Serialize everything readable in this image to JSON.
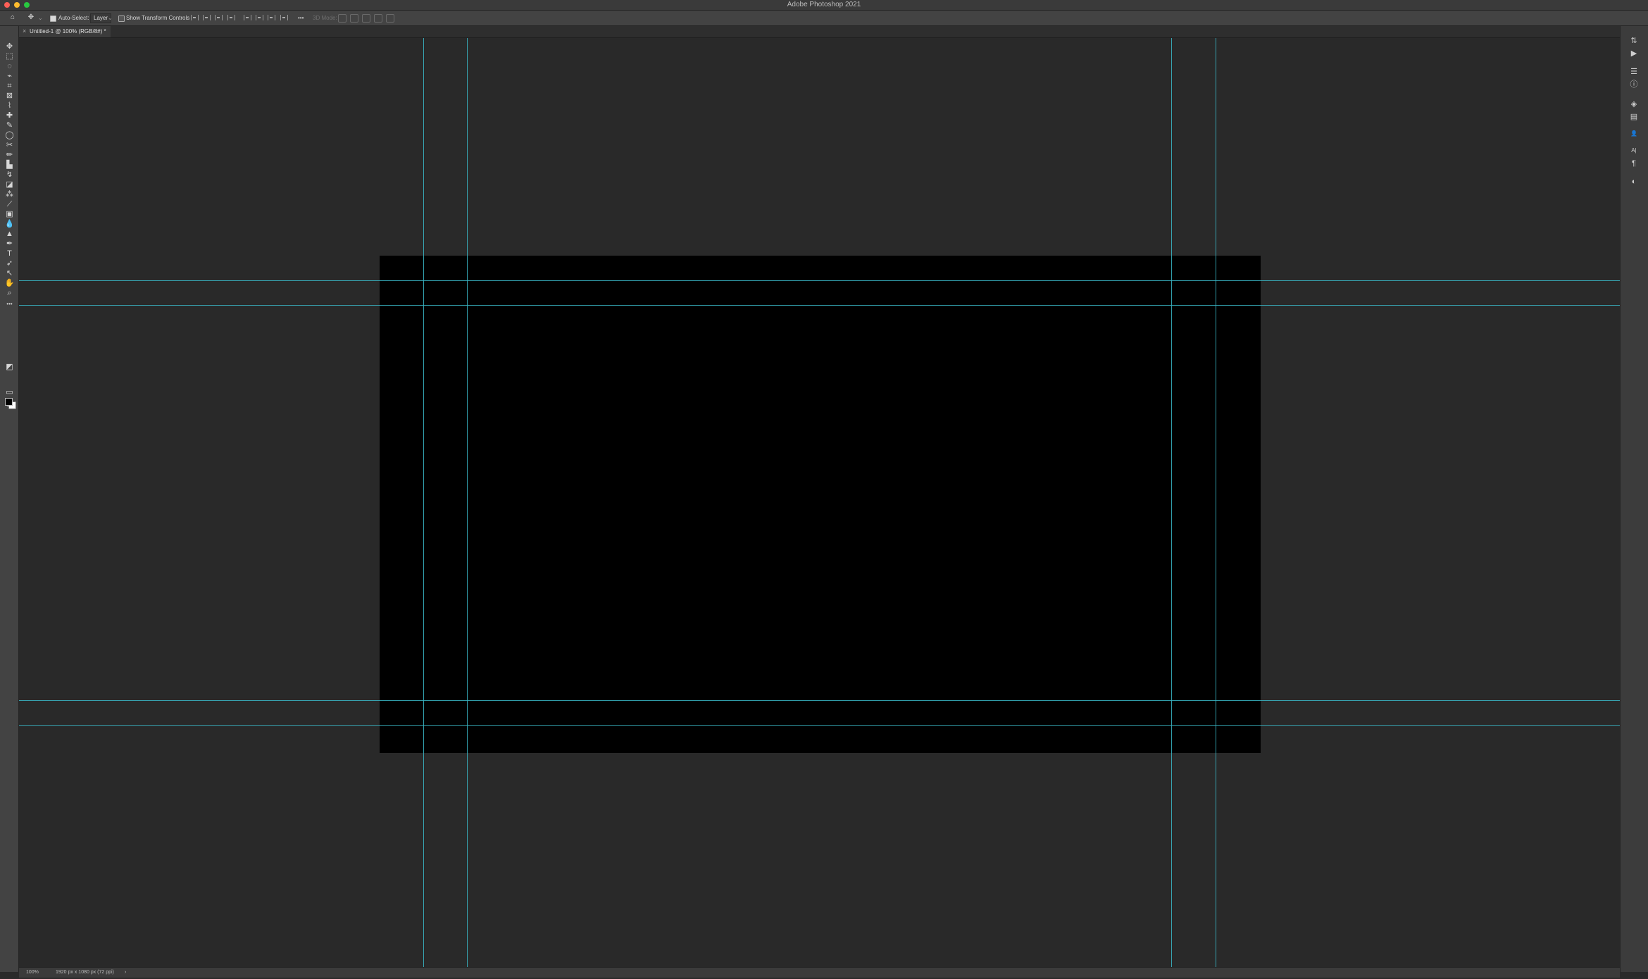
{
  "app_title": "Adobe Photoshop 2021",
  "options_bar": {
    "auto_select_label": "Auto-Select:",
    "auto_select_checked": true,
    "auto_select_target": "Layer",
    "show_transform_label": "Show Transform Controls",
    "show_transform_checked": false,
    "more_label": "•••",
    "mode_3d_label": "3D Mode:"
  },
  "document_tab": {
    "title": "Untitled-1 @ 100% (RGB/8#) *",
    "close_glyph": "×"
  },
  "tools": [
    {
      "name": "move-tool",
      "glyph": "✥"
    },
    {
      "name": "marquee-tool",
      "glyph": "⬚"
    },
    {
      "name": "lasso-tool",
      "glyph": "◌"
    },
    {
      "name": "object-select-tool",
      "glyph": "⌁"
    },
    {
      "name": "crop-tool",
      "glyph": "⌗"
    },
    {
      "name": "frame-tool",
      "glyph": "⊠"
    },
    {
      "name": "eyedropper-tool",
      "glyph": "⌇"
    },
    {
      "name": "healing-brush-tool",
      "glyph": "✚"
    },
    {
      "name": "brush-tool",
      "glyph": "✎"
    },
    {
      "name": "ellipse-tool",
      "glyph": "◯"
    },
    {
      "name": "scissors-tool",
      "glyph": "✂"
    },
    {
      "name": "pencil-tool",
      "glyph": "✏"
    },
    {
      "name": "stamp-tool",
      "glyph": "▙"
    },
    {
      "name": "history-brush-tool",
      "glyph": "↯"
    },
    {
      "name": "eraser-tool",
      "glyph": "◪"
    },
    {
      "name": "magic-wand-tool",
      "glyph": "⁂"
    },
    {
      "name": "brush-alt-tool",
      "glyph": "⟋"
    },
    {
      "name": "gradient-tool",
      "glyph": "▣"
    },
    {
      "name": "blur-tool",
      "glyph": "💧"
    },
    {
      "name": "dodge-tool",
      "glyph": "▲"
    },
    {
      "name": "pen-tool",
      "glyph": "✒"
    },
    {
      "name": "type-tool",
      "glyph": "T"
    },
    {
      "name": "path-select-tool",
      "glyph": "➶"
    },
    {
      "name": "direct-select-tool",
      "glyph": "↖"
    },
    {
      "name": "hand-tool",
      "glyph": "✋"
    },
    {
      "name": "zoom-tool",
      "glyph": "⌕"
    },
    {
      "name": "more-tools",
      "glyph": "•••"
    },
    {
      "name": "default-colors",
      "glyph": "◩"
    },
    {
      "name": "quick-mask",
      "glyph": "▭"
    },
    {
      "name": "screen-mode",
      "glyph": "⧉"
    }
  ],
  "right_panel_icons": [
    {
      "name": "history-panel-icon",
      "glyph": "⇅"
    },
    {
      "name": "actions-panel-icon",
      "glyph": "▶"
    },
    {
      "name": "adjustments-panel-icon",
      "glyph": "☰"
    },
    {
      "name": "info-panel-icon",
      "glyph": "ⓘ"
    },
    {
      "name": "layers-panel-icon",
      "glyph": "◈"
    },
    {
      "name": "channels-panel-icon",
      "glyph": "▤"
    },
    {
      "name": "people-panel-icon",
      "glyph": "👤"
    },
    {
      "name": "character-panel-icon",
      "glyph": "A|"
    },
    {
      "name": "paragraph-panel-icon",
      "glyph": "¶"
    },
    {
      "name": "properties-panel-icon",
      "glyph": "◐"
    }
  ],
  "status_bar": {
    "zoom": "100%",
    "doc_info": "1920 px x 1080 px (72 ppi)",
    "arrow": "›"
  },
  "colors": {
    "guide": "#39b8c8",
    "canvas_fill": "#000000",
    "workspace": "#292929"
  }
}
